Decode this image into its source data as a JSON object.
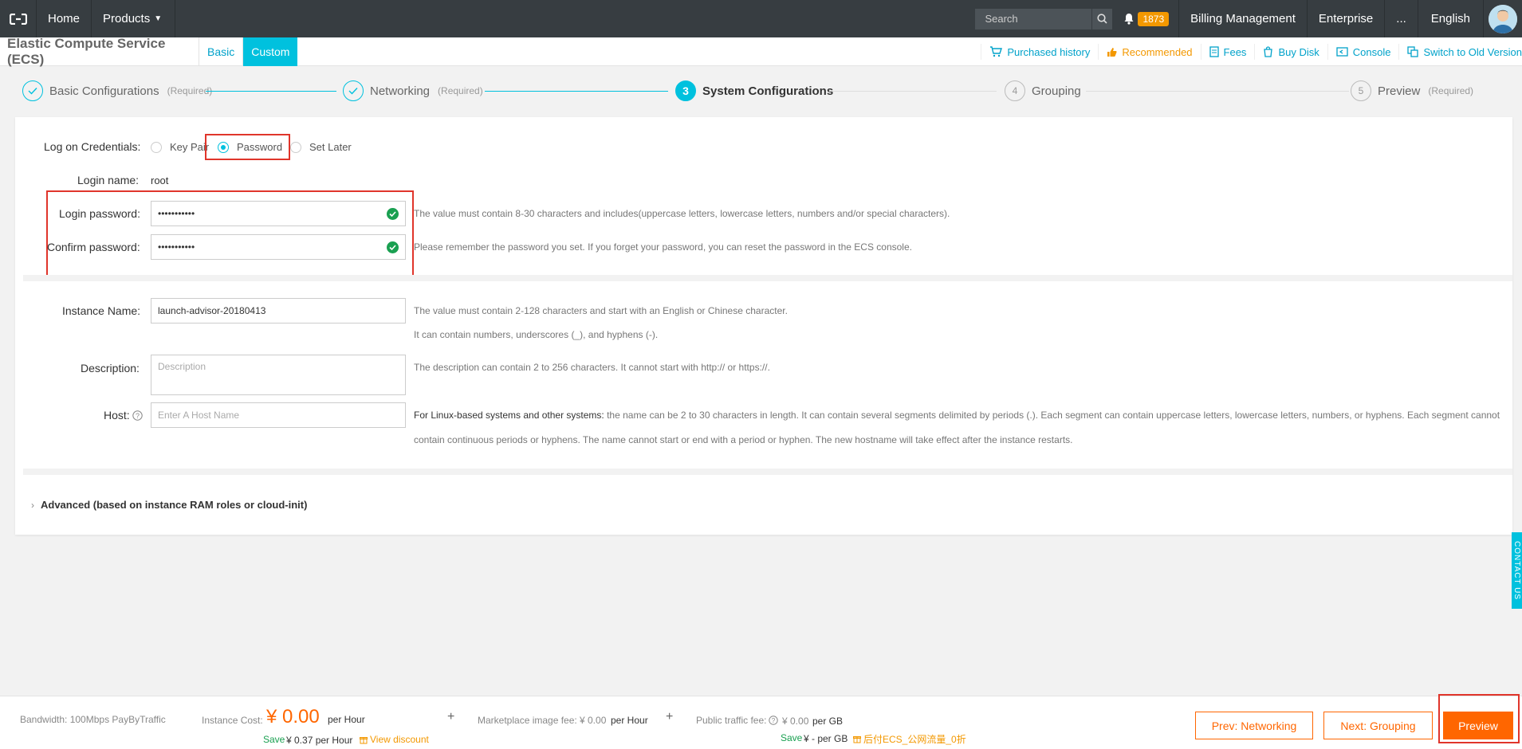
{
  "topbar": {
    "home": "Home",
    "products": "Products",
    "search_placeholder": "Search",
    "notifications": "1873",
    "billing": "Billing Management",
    "enterprise": "Enterprise",
    "more": "...",
    "language": "English"
  },
  "subbar": {
    "title": "Elastic Compute Service (ECS)",
    "tabs": [
      "Basic",
      "Custom"
    ],
    "links": [
      "Purchased history",
      "Recommended",
      "Fees",
      "Buy Disk",
      "Console",
      "Switch to Old Version"
    ]
  },
  "steps": [
    {
      "num": "",
      "label": "Basic Configurations",
      "req": "(Required)"
    },
    {
      "num": "",
      "label": "Networking",
      "req": "(Required)"
    },
    {
      "num": "3",
      "label": "System Configurations",
      "req": ""
    },
    {
      "num": "4",
      "label": "Grouping",
      "req": ""
    },
    {
      "num": "5",
      "label": "Preview",
      "req": "(Required)"
    }
  ],
  "form": {
    "credentials_label": "Log on Credentials",
    "credentials_options": [
      "Key Pair",
      "Password",
      "Set Later"
    ],
    "selected_option": "Password",
    "login_name_label": "Login name",
    "login_name_value": "root",
    "login_password_label": "Login password",
    "login_password_value": "•••••••••••",
    "login_password_hint": "The value must contain 8-30 characters and includes(uppercase letters, lowercase letters, numbers and/or special characters).",
    "confirm_password_label": "Confirm password",
    "confirm_password_value": "•••••••••••",
    "confirm_password_hint": "Please remember the password you set. If you forget your password, you can reset the password in the ECS console.",
    "instance_name_label": "Instance Name",
    "instance_name_value": "launch-advisor-20180413",
    "instance_name_hint1": "The value must contain 2-128 characters and start with an English or Chinese character.",
    "instance_name_hint2": "It can contain numbers, underscores (_), and hyphens (-).",
    "description_label": "Description",
    "description_placeholder": "Description",
    "description_hint": "The description can contain 2 to 256 characters. It cannot start with http:// or https://.",
    "host_label": "Host",
    "host_placeholder": "Enter A Host Name",
    "host_hint_bold": "For Linux-based systems and other systems:",
    "host_hint1": " the name can be 2 to 30 characters in length. It can contain several segments delimited by periods (.). Each segment can contain uppercase letters, lowercase letters, numbers, or hyphens. Each segment cannot",
    "host_hint2": "contain continuous periods or hyphens. The name cannot start or end with a period or hyphen. The new hostname will take effect after the instance restarts.",
    "advanced": "Advanced (based on instance RAM roles or cloud-init)"
  },
  "contact": "CONTACT US",
  "footer": {
    "bandwidth": "Bandwidth: 100Mbps PayByTraffic",
    "instance_cost_label": "Instance Cost:",
    "instance_cost_value": "¥ 0.00",
    "per_hour": "per Hour",
    "save_label": "Save",
    "save_value": "¥ 0.37 per Hour",
    "view_discount": "View discount",
    "marketplace_label": "Marketplace image fee:",
    "marketplace_value": "¥ 0.00",
    "public_traffic_label": "Public traffic fee:",
    "public_traffic_value": "¥ 0.00",
    "per_gb": "per GB",
    "save_gb": "¥ - per GB",
    "discount_note": "后付ECS_公网流量_0折",
    "plus": "+",
    "prev": "Prev: Networking",
    "next": "Next: Grouping",
    "preview": "Preview"
  },
  "colors": {
    "accent": "#00c1de",
    "orange": "#f60",
    "highlight": "#e0352b",
    "success": "#1aa051"
  }
}
